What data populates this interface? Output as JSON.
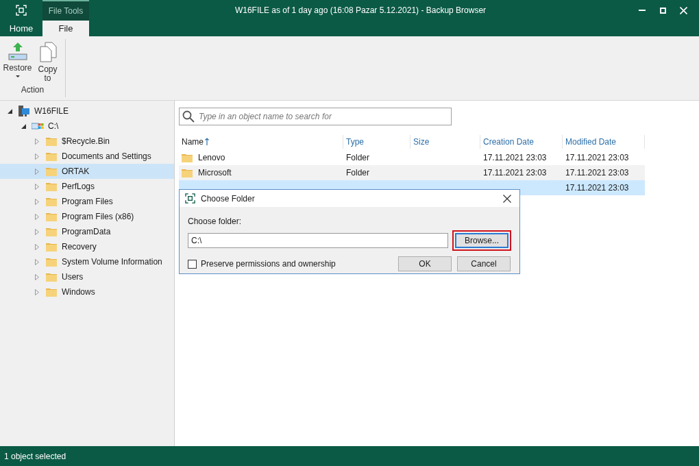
{
  "window": {
    "title": "W16FILE as of 1 day ago (16:08 Pazar 5.12.2021) - Backup Browser"
  },
  "context_tab": "File Tools",
  "tabs": [
    {
      "label": "Home",
      "selected": false
    },
    {
      "label": "File",
      "selected": true
    }
  ],
  "ribbon": {
    "buttons": [
      {
        "label": "Restore",
        "kind": "restore"
      },
      {
        "label": "Copy to",
        "kind": "copy"
      }
    ],
    "group": "Action"
  },
  "tree": [
    {
      "label": "W16FILE",
      "kind": "server",
      "expanded": true,
      "selected": false,
      "children": [
        {
          "label": "C:\\",
          "kind": "drive",
          "expanded": true,
          "selected": false,
          "children": [
            {
              "label": "$Recycle.Bin",
              "kind": "folder",
              "expanded": false,
              "selected": false
            },
            {
              "label": "Documents and Settings",
              "kind": "folder",
              "expanded": false,
              "selected": false
            },
            {
              "label": "ORTAK",
              "kind": "folder",
              "expanded": false,
              "selected": true
            },
            {
              "label": "PerfLogs",
              "kind": "folder",
              "expanded": false,
              "selected": false
            },
            {
              "label": "Program Files",
              "kind": "folder",
              "expanded": false,
              "selected": false
            },
            {
              "label": "Program Files (x86)",
              "kind": "folder",
              "expanded": false,
              "selected": false
            },
            {
              "label": "ProgramData",
              "kind": "folder",
              "expanded": false,
              "selected": false
            },
            {
              "label": "Recovery",
              "kind": "folder",
              "expanded": false,
              "selected": false
            },
            {
              "label": "System Volume Information",
              "kind": "folder",
              "expanded": false,
              "selected": false
            },
            {
              "label": "Users",
              "kind": "folder",
              "expanded": false,
              "selected": false
            },
            {
              "label": "Windows",
              "kind": "folder",
              "expanded": false,
              "selected": false
            }
          ]
        }
      ]
    }
  ],
  "search": {
    "placeholder": "Type in an object name to search for"
  },
  "table": {
    "columns": [
      "Name",
      "Type",
      "Size",
      "Creation Date",
      "Modified Date"
    ],
    "rows": [
      {
        "name": "Lenovo",
        "type": "Folder",
        "creation_date": "17.11.2021 23:03",
        "modified_date": "17.11.2021 23:03",
        "selected": false
      },
      {
        "name": "Microsoft",
        "type": "Folder",
        "creation_date": "17.11.2021 23:03",
        "modified_date": "17.11.2021 23:03",
        "selected": false
      },
      {
        "modified_date": "17.11.2021 23:03",
        "selected": true
      }
    ]
  },
  "dialog": {
    "title": "Choose Folder",
    "field_label": "Choose folder:",
    "value": "C:\\",
    "checkbox": {
      "label": "Preserve permissions and ownership",
      "checked": false
    },
    "browse": "Browse...",
    "ok": "OK",
    "cancel": "Cancel"
  },
  "status_bar": "1 object selected"
}
